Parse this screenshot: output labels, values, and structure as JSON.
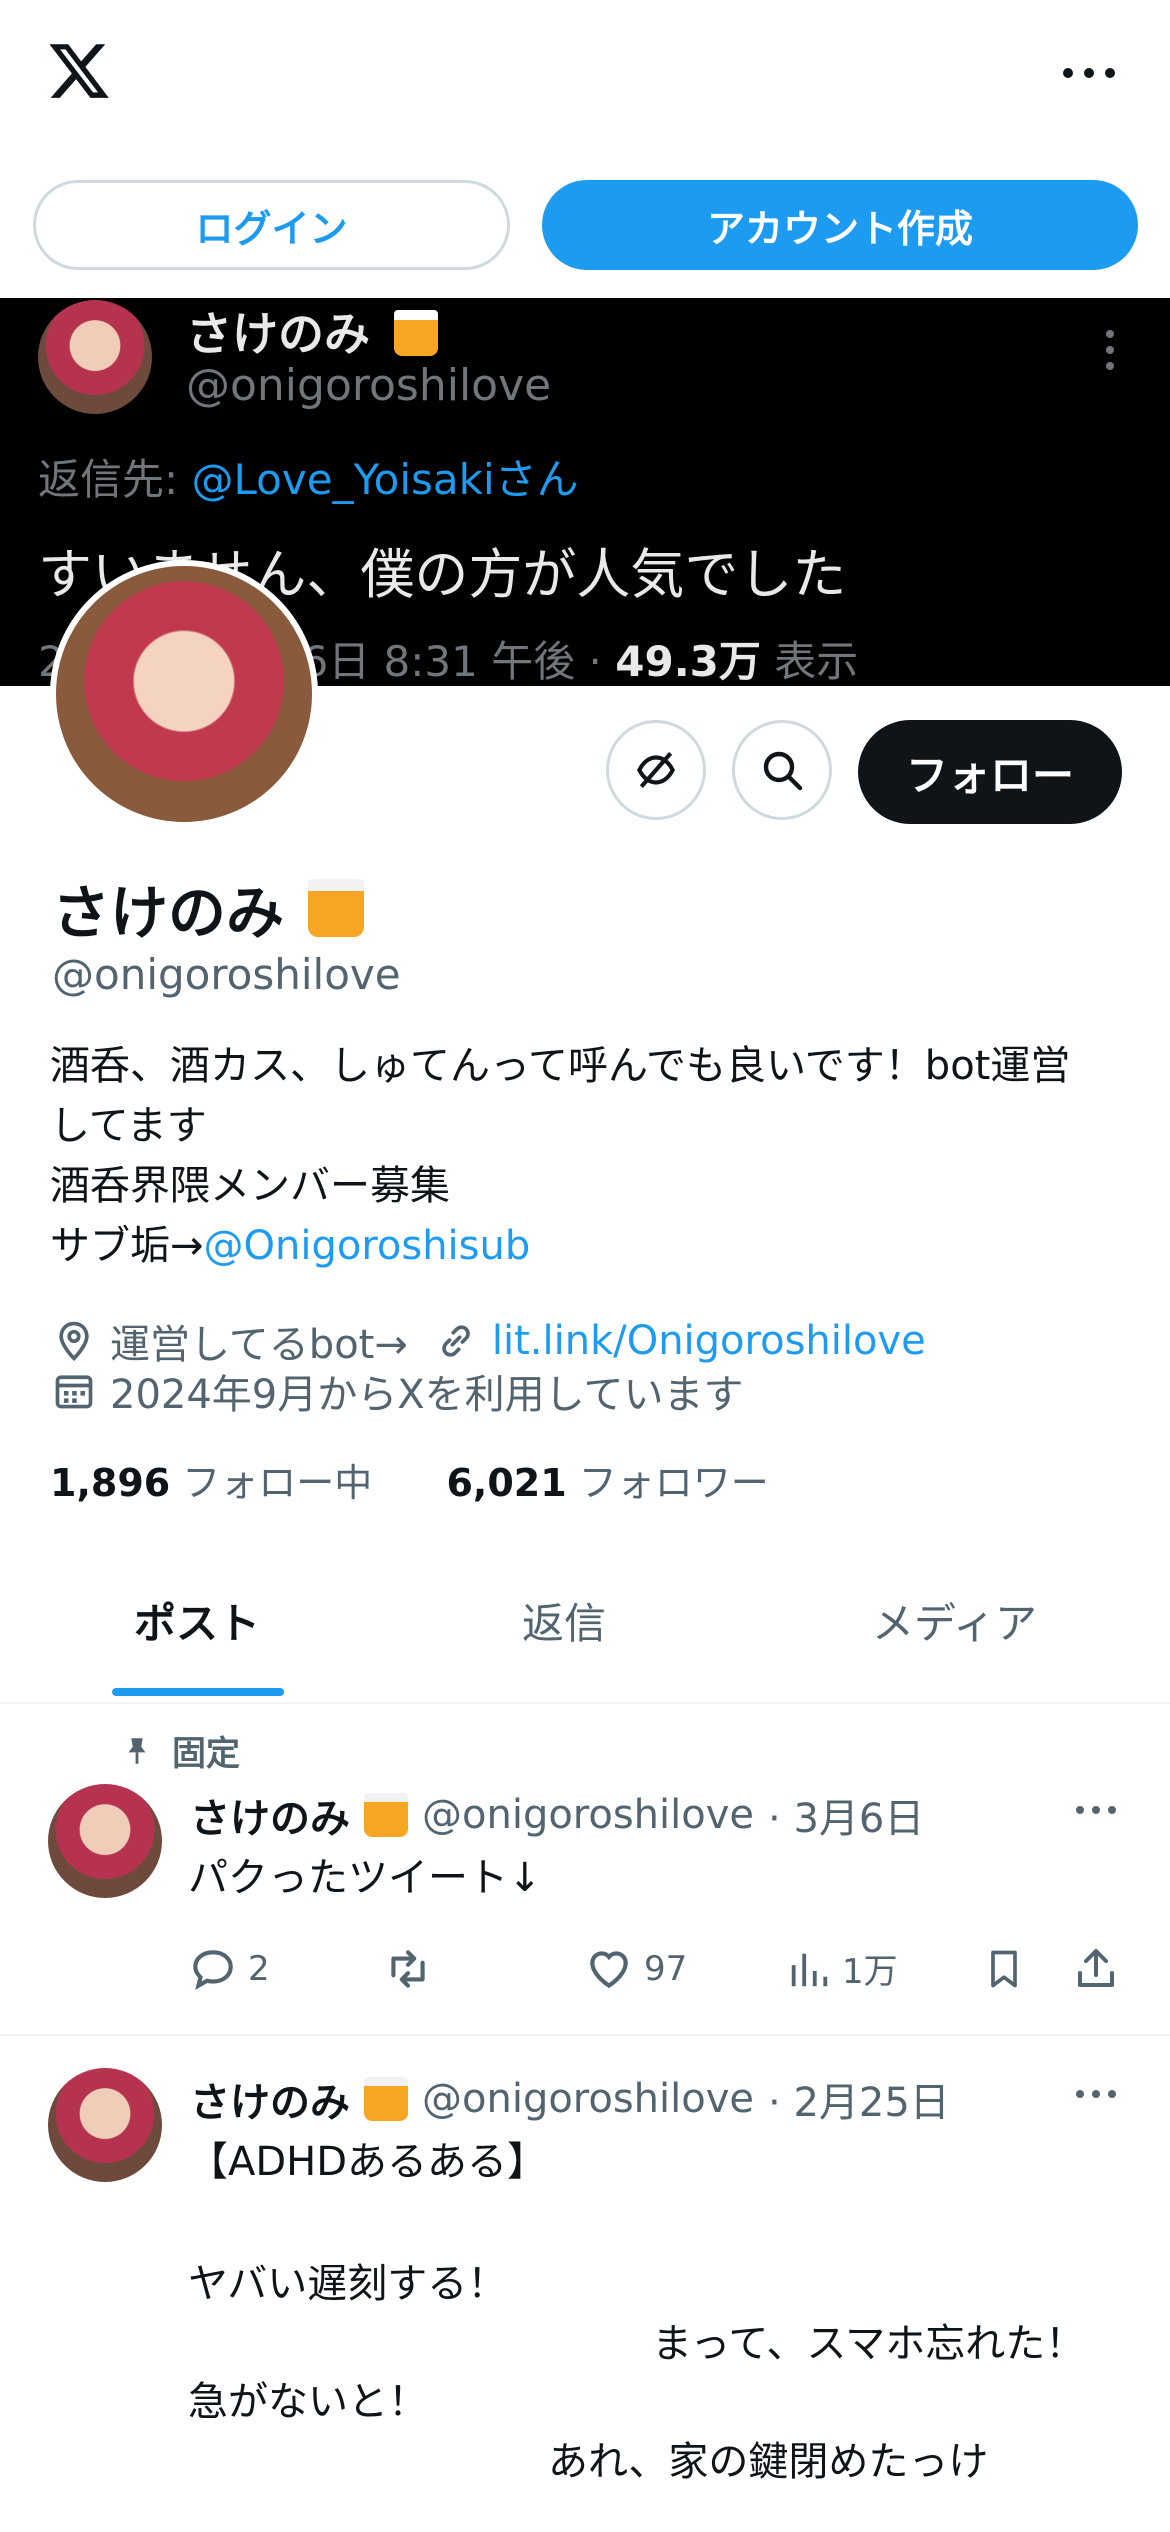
{
  "header": {
    "login_label": "ログイン",
    "signup_label": "アカウント作成"
  },
  "banner": {
    "name": "さけのみ",
    "handle": "@onigoroshilove",
    "reply_prefix": "返信先: ",
    "reply_to": "@Love_Yoisakiさん",
    "text": "すいません、僕の方が人気でした",
    "meta_date": "2",
    "meta_date_tail": "26日 8:31 午後 · ",
    "views": "49.3万",
    "views_label": " 表示"
  },
  "profile": {
    "follow_label": "フォロー",
    "name": "さけのみ",
    "handle": "@onigoroshilove",
    "bio_line1": "酒呑、酒カス、しゅてんって呼んでも良いです！bot運営",
    "bio_line2": "してます",
    "bio_line3": "酒呑界隈メンバー募集",
    "bio_line4_prefix": "サブ垢→",
    "bio_line4_link": "@Onigoroshisub",
    "location": "運営してるbot→",
    "website": "lit.link/Onigoroshilove",
    "joined": "2024年9月からXを利用しています",
    "following_count": "1,896",
    "following_label": " フォロー中",
    "followers_count": "6,021",
    "followers_label": " フォロワー"
  },
  "tabs": [
    {
      "label": "ポスト"
    },
    {
      "label": "返信"
    },
    {
      "label": "メディア"
    }
  ],
  "posts": [
    {
      "pinned_label": "固定",
      "name": "さけのみ",
      "handle": "@onigoroshilove",
      "date": "· 3月6日",
      "text": "パクったツイート↓",
      "replies": "2",
      "likes": "97",
      "views": "1万"
    },
    {
      "name": "さけのみ",
      "handle": "@onigoroshilove",
      "date": "· 2月25日",
      "line1": "【ADHDあるある】",
      "line2": "ヤバい遅刻する！",
      "line3": "まって、スマホ忘れた！",
      "line4": "急がないと！",
      "line5": "あれ、家の鍵閉めたっけ"
    }
  ]
}
